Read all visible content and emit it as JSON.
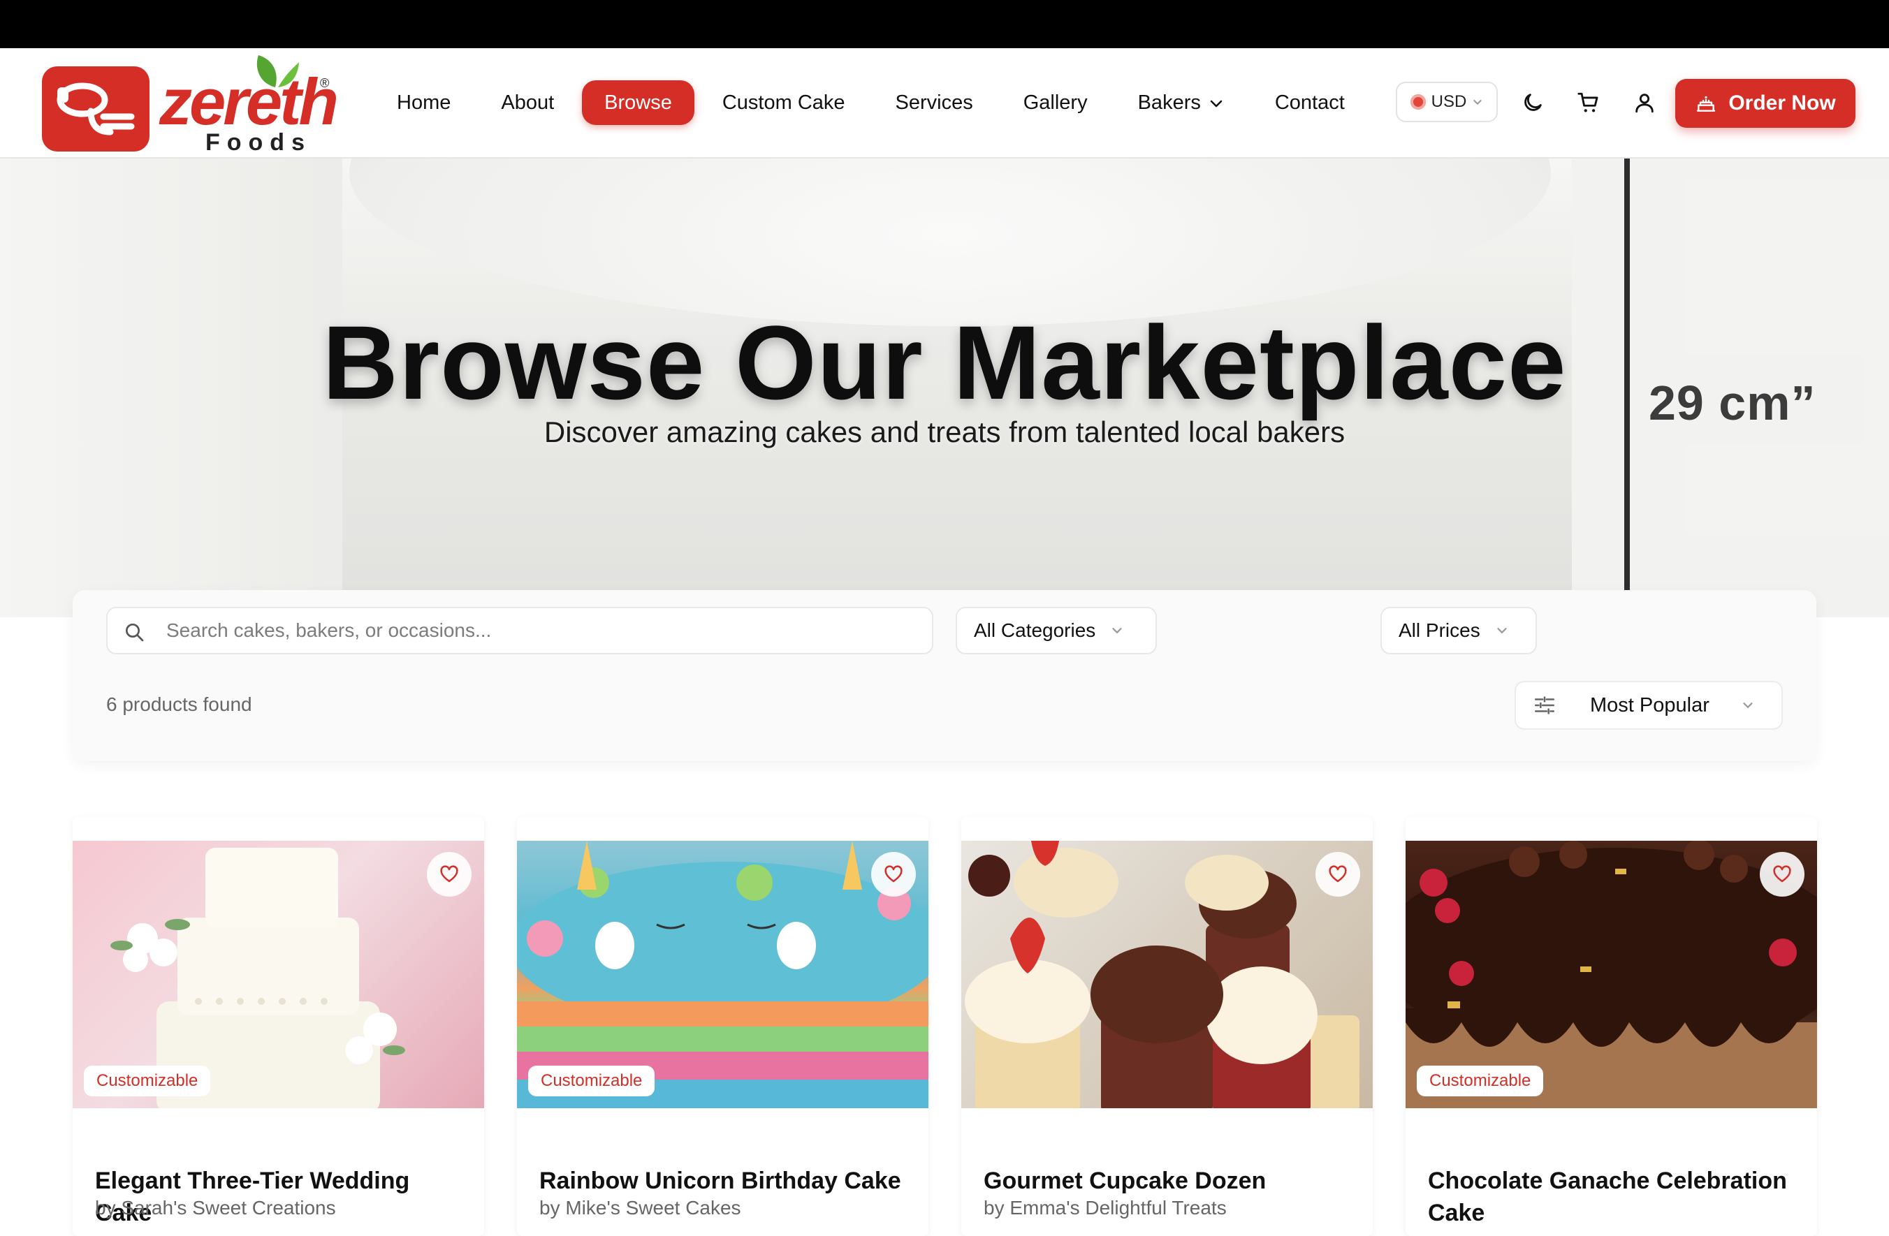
{
  "brand": {
    "name": "zereth",
    "sub": "Foods",
    "reg": "®"
  },
  "nav": {
    "items": [
      {
        "label": "Home"
      },
      {
        "label": "About"
      },
      {
        "label": "Browse"
      },
      {
        "label": "Custom Cake"
      },
      {
        "label": "Services"
      },
      {
        "label": "Gallery"
      },
      {
        "label": "Bakers"
      },
      {
        "label": "Contact"
      }
    ],
    "active": "Browse"
  },
  "currency": {
    "value": "USD"
  },
  "header_icons": [
    "moon-icon",
    "cart-icon",
    "user-icon"
  ],
  "order_button": {
    "label": "Order Now"
  },
  "hero": {
    "title": "Browse Our Marketplace",
    "subtitle": "Discover amazing cakes and treats from talented local bakers",
    "dimension_text": "29 cm”"
  },
  "filters": {
    "search_placeholder": "Search cakes, bakers, or occasions...",
    "category": "All Categories",
    "price": "All Prices",
    "count_text": "6 products found",
    "sort": "Most Popular"
  },
  "products": [
    {
      "title": "Elegant Three-Tier Wedding Cake",
      "by": "by Sarah's Sweet Creations",
      "badge": "Customizable"
    },
    {
      "title": "Rainbow Unicorn Birthday Cake",
      "by": "by Mike's Sweet Cakes",
      "badge": "Customizable"
    },
    {
      "title": "Gourmet Cupcake Dozen",
      "by": "by Emma's Delightful Treats",
      "badge": ""
    },
    {
      "title": "Chocolate Ganache Celebration Cake",
      "by": "",
      "badge": "Customizable"
    }
  ],
  "colors": {
    "accent": "#d42e27",
    "topbar": "#000000"
  }
}
